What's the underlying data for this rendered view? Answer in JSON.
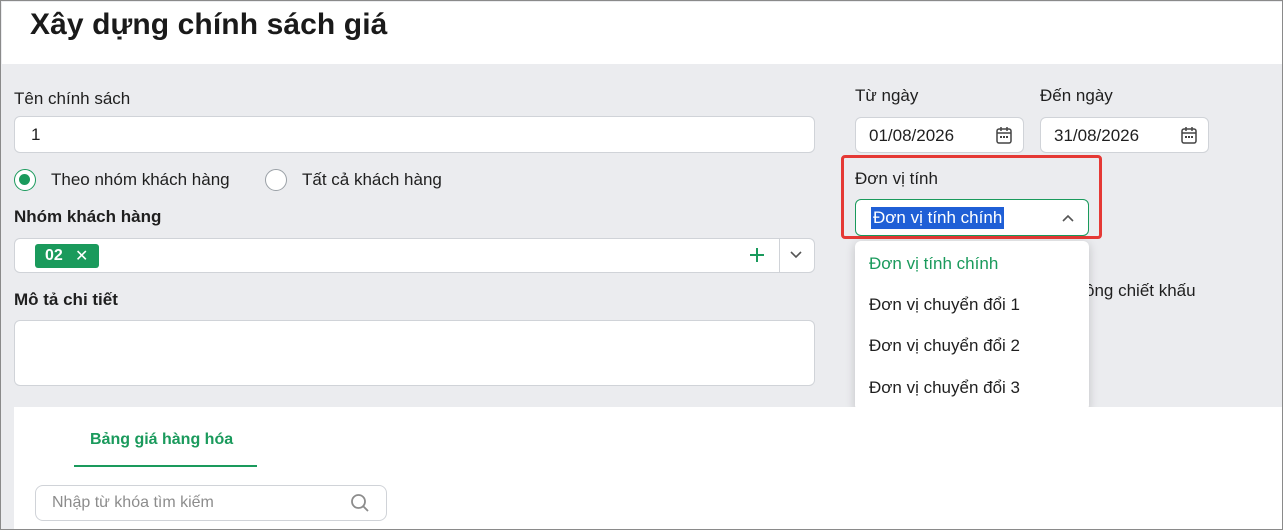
{
  "page": {
    "title": "Xây dựng chính sách giá"
  },
  "form": {
    "policy_name_label": "Tên chính sách",
    "policy_name_value": "1",
    "radio_by_group": "Theo nhóm khách hàng",
    "radio_all": "Tất cả khách hàng",
    "customer_group_label": "Nhóm khách hàng",
    "customer_group_tags": [
      "02"
    ],
    "tag_remove_glyph": "✕",
    "description_label": "Mô tả chi tiết",
    "description_value": "",
    "from_date_label": "Từ ngày",
    "from_date_value": "01/08/2026",
    "to_date_label": "Đến ngày",
    "to_date_value": "31/08/2026",
    "unit_label": "Đơn vị tính",
    "unit_selected": "Đơn vị tính chính",
    "unit_options": [
      "Đơn vị tính chính",
      "Đơn vị chuyển đổi 1",
      "Đơn vị chuyển đổi 2",
      "Đơn vị chuyển đổi 3"
    ],
    "hidden_partial_label": "ông chiết khấu"
  },
  "tabs": {
    "price_table": "Bảng giá hàng hóa"
  },
  "search": {
    "placeholder": "Nhập từ khóa tìm kiếm"
  },
  "colors": {
    "accent": "#1a9a5c",
    "highlight": "#e53935",
    "selection": "#1f5fd6"
  }
}
